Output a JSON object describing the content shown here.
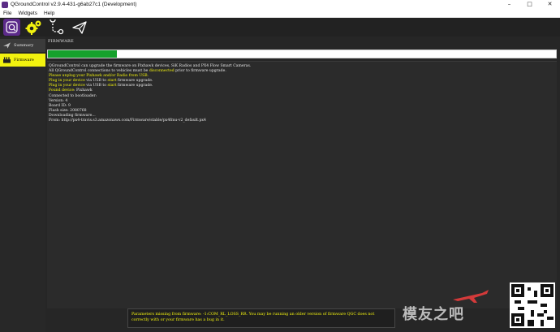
{
  "window": {
    "title": "QGroundControl v2.9.4-431-g6ab27c1 (Development)",
    "minimize_glyph": "–",
    "maximize_glyph": "□",
    "close_glyph": "✕"
  },
  "menu": {
    "file": "File",
    "widgets": "Widgets",
    "help": "Help"
  },
  "toolbar": {
    "icons": [
      "qgc-logo-icon",
      "gear-icon",
      "plan-route-icon",
      "paper-plane-icon"
    ],
    "accent": "#f2f20f",
    "logo_bg": "#5c2a8a"
  },
  "sidebar": {
    "items": [
      {
        "label": "Summary",
        "icon": "plane-icon",
        "selected": false
      },
      {
        "label": "Firmware",
        "icon": "firmware-icon",
        "selected": true
      }
    ]
  },
  "main": {
    "heading": "FIRMWARE",
    "progress": 0.135,
    "progress_color": "#16a12c"
  },
  "log": {
    "l1": "QGroundControl can upgrade the firmware on Pixhawk devices, SiK Radios and PX4 Flow Smart Cameras.",
    "l2a": "All QGroundControl connections to vehicles must be ",
    "l2b": "disconnected",
    "l2c": " prior to firmware upgrade.",
    "l3": "Please unplug your Pixhawk and/or Radio from USB.",
    "l4a": "Plug in your device",
    "l4b": " via USB to ",
    "l4c": "start",
    "l4d": " firmware upgrade.",
    "l5a": "Plug in your device",
    "l5b": " via USB to ",
    "l5c": "start",
    "l5d": " firmware upgrade.",
    "l6a": "Found device",
    "l6b": ": Pixhawk",
    "l7": "Connected to bootloader:",
    "l8": "Version: 4",
    "l9": "Board ID: 9",
    "l10": "Flash size: 2080768",
    "l11": "Downloading firmware...",
    "l12": "From: http://px4-travis.s3.amazonaws.com/Firmware/stable/px4fmu-v2_default.px4"
  },
  "message": {
    "line1": "Parameters missing from firmware: -1:COM_RL_LOSS_RR. You may be running an older version of firmware QGC does not",
    "line2": "correctly with or your firmware has a bug in it."
  },
  "watermark": {
    "text": "模友之吧"
  }
}
